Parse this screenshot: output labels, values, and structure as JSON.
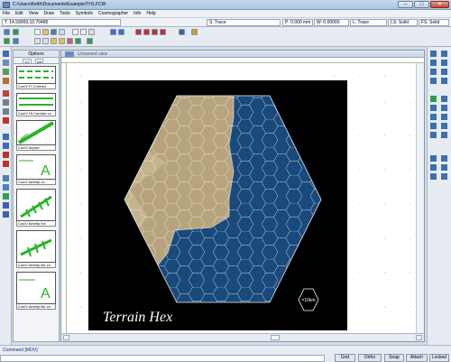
{
  "window": {
    "title": "C:\\Users\\Keith\\Documents\\Example\\TH1.FCW",
    "minimize": "–",
    "maximize": "□",
    "close": "✕"
  },
  "menu": [
    "File",
    "Edit",
    "View",
    "Draw",
    "Tools",
    "Symbols",
    "Cosmographer",
    "Info",
    "Help"
  ],
  "status": {
    "coords": "T: 14.59969,10.70486",
    "color": "S: Trace",
    "pen": "P: 0.000 mm",
    "width": "W: 0.00000",
    "layer": "L: Trace",
    "line_style": "LS: Solid",
    "fill_style": "FS: Solid"
  },
  "options": {
    "title": "Options",
    "tabs": [
      "1/2",
      "pal"
    ],
    "symbols": [
      "Cos\\V Ft Corridor",
      "Cos\\V Ht Corridor vo",
      "Cos\\V Airport",
      "Cos\\V Airstrip vo",
      "Cos\\V Airstrip fvs",
      "Cos\\V Airstrip lite vo",
      "Cos\\V Airstrip lite vo"
    ]
  },
  "view": {
    "title": "Unnamed view"
  },
  "map": {
    "title": "Terrain Hex",
    "scale": "=10km",
    "colors": {
      "space": "#000000",
      "sea": "#1a4a7c",
      "land": "#b8a47c",
      "grid": "#e8eef6"
    }
  },
  "command": {
    "label": "Command [MOV]"
  },
  "modes": [
    "Grid",
    "Ortho",
    "Snap",
    "Attach",
    "Locked"
  ],
  "colors": {
    "accent": "#3a6fb0",
    "symbol_green": "#28b428"
  }
}
